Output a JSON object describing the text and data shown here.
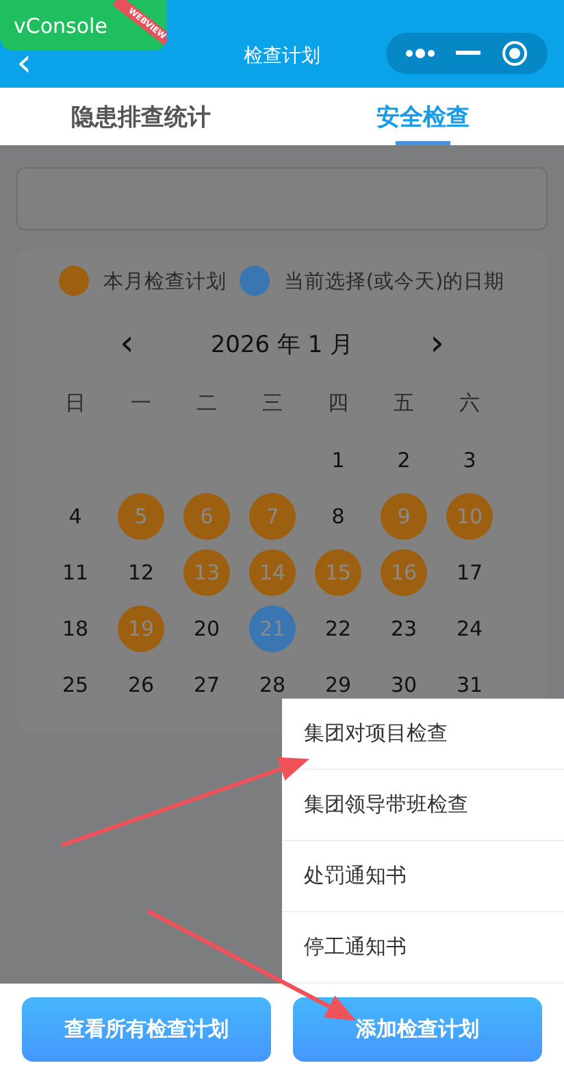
{
  "dev_badge": {
    "label": "vConsole",
    "ribbon": "WEBVIEW"
  },
  "header": {
    "back": "‹",
    "title": "检查计划"
  },
  "tabs": [
    {
      "label": "隐患排查统计",
      "selected": false
    },
    {
      "label": "安全检查",
      "selected": true
    }
  ],
  "calendar": {
    "legend": [
      {
        "label": "本月检查计划",
        "color": "#9c6010"
      },
      {
        "label": "当前选择(或今天)的日期",
        "color": "#3a76b2"
      }
    ],
    "prev": "‹",
    "month": "2026 年 1 月",
    "next": "›",
    "weekdays": [
      "日",
      "一",
      "二",
      "三",
      "四",
      "五",
      "六"
    ],
    "weeks": [
      [
        {
          "kind": "blank"
        },
        {
          "kind": "blank"
        },
        {
          "kind": "blank"
        },
        {
          "kind": "blank"
        },
        {
          "day": "1",
          "plan": false,
          "selected": false
        },
        {
          "day": "2",
          "plan": false,
          "selected": false
        },
        {
          "day": "3",
          "plan": false,
          "selected": false
        }
      ],
      [
        {
          "day": "4",
          "plan": false,
          "selected": false
        },
        {
          "day": "5",
          "plan": true,
          "selected": false
        },
        {
          "day": "6",
          "plan": true,
          "selected": false
        },
        {
          "day": "7",
          "plan": true,
          "selected": false
        },
        {
          "day": "8",
          "plan": false,
          "selected": false
        },
        {
          "day": "9",
          "plan": true,
          "selected": false
        },
        {
          "day": "10",
          "plan": true,
          "selected": false
        }
      ],
      [
        {
          "day": "11",
          "plan": false,
          "selected": false
        },
        {
          "day": "12",
          "plan": false,
          "selected": false
        },
        {
          "day": "13",
          "plan": true,
          "selected": false
        },
        {
          "day": "14",
          "plan": true,
          "selected": false
        },
        {
          "day": "15",
          "plan": true,
          "selected": false
        },
        {
          "day": "16",
          "plan": true,
          "selected": false
        },
        {
          "day": "17",
          "plan": false,
          "selected": false
        }
      ],
      [
        {
          "day": "18",
          "plan": false,
          "selected": false
        },
        {
          "day": "19",
          "plan": true,
          "selected": false
        },
        {
          "day": "20",
          "plan": false,
          "selected": false
        },
        {
          "day": "21",
          "plan": false,
          "selected": true
        },
        {
          "day": "22",
          "plan": false,
          "selected": false
        },
        {
          "day": "23",
          "plan": false,
          "selected": false
        },
        {
          "day": "24",
          "plan": false,
          "selected": false
        }
      ],
      [
        {
          "day": "25",
          "plan": false,
          "selected": false
        },
        {
          "day": "26",
          "plan": false,
          "selected": false
        },
        {
          "day": "27",
          "plan": false,
          "selected": false
        },
        {
          "day": "28",
          "plan": false,
          "selected": false
        },
        {
          "day": "29",
          "plan": false,
          "selected": false
        },
        {
          "day": "30",
          "plan": false,
          "selected": false
        },
        {
          "day": "31",
          "plan": false,
          "selected": false
        }
      ]
    ]
  },
  "menu": [
    "集团对项目检查",
    "集团领导带班检查",
    "处罚通知书",
    "停工通知书"
  ],
  "buttons": [
    "查看所有检查计划",
    "添加检查计划"
  ]
}
